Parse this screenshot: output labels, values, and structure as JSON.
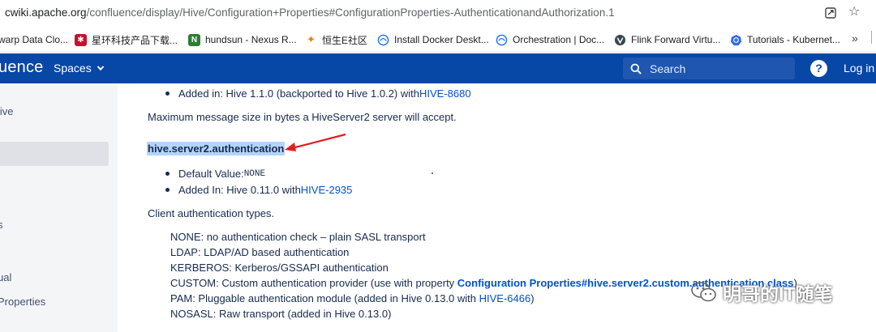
{
  "browser": {
    "url_host": "cwiki.apache.org",
    "url_path": "/confluence/display/Hive/Configuration+Properties#ConfigurationProperties-AuthenticationandAuthorization.1",
    "bookmarks": [
      {
        "label": "warp Data Clo...",
        "icon": "blank-icon",
        "color": ""
      },
      {
        "label": "星环科技产品下载...",
        "icon": "star-logo-icon",
        "color": "#c8102e"
      },
      {
        "label": "hundsun - Nexus R...",
        "icon": "nexus-n-icon",
        "color": "#2e7d32"
      },
      {
        "label": "恒生E社区",
        "icon": "flame-icon",
        "color": "#f57c00"
      },
      {
        "label": "Install Docker Deskt...",
        "icon": "globe-icon",
        "color": "#1a73e8"
      },
      {
        "label": "Orchestration | Doc...",
        "icon": "globe-icon",
        "color": "#1a73e8"
      },
      {
        "label": "Flink Forward Virtu...",
        "icon": "flink-v-icon",
        "color": "#37474f"
      },
      {
        "label": "Tutorials - Kubernet...",
        "icon": "kubernetes-icon",
        "color": "#326ce5"
      }
    ],
    "more_label": "»"
  },
  "header": {
    "logo_text": "uence",
    "spaces_label": "Spaces",
    "search_placeholder": "Search",
    "help_label": "?",
    "login_label": "Log in",
    "bg_color": "#0747a6"
  },
  "sidebar": {
    "items": [
      {
        "label": "live"
      },
      {
        "label": "s"
      },
      {
        "label": "ual"
      },
      {
        "label": " Properties"
      }
    ],
    "handle_label": "||"
  },
  "content": {
    "added_prev": {
      "prefix": "Added in: Hive 1.1.0 (backported to Hive 1.0.2) with ",
      "link": "HIVE-8680"
    },
    "max_msg_desc": "Maximum message size in bytes a HiveServer2 server will accept.",
    "property_name": "hive.server2.authentication",
    "default_label": "Default Value: ",
    "default_value": "NONE",
    "added_in": {
      "prefix": "Added In: Hive 0.11.0 with ",
      "link": "HIVE-2935"
    },
    "desc": "Client authentication types.",
    "types": {
      "none": "NONE: no authentication check – plain SASL transport",
      "ldap": "LDAP: LDAP/AD based authentication",
      "kerberos": "KERBEROS: Kerberos/GSSAPI authentication",
      "custom_prefix": "CUSTOM: Custom authentication provider (use with property ",
      "custom_link": "Configuration Properties#hive.server2.custom.authentication.class",
      "custom_suffix": ")",
      "pam_prefix": "PAM: Pluggable authentication module (added in Hive 0.13.0 with ",
      "pam_link": "HIVE-6466",
      "pam_suffix": ")",
      "nosasl": "NOSASL:  Raw transport (added in Hive 0.13.0)"
    },
    "watermark": "明哥的IT随笔"
  },
  "colors": {
    "link": "#0052cc",
    "highlight": "#b3d4ff",
    "arrow": "#e02020"
  }
}
